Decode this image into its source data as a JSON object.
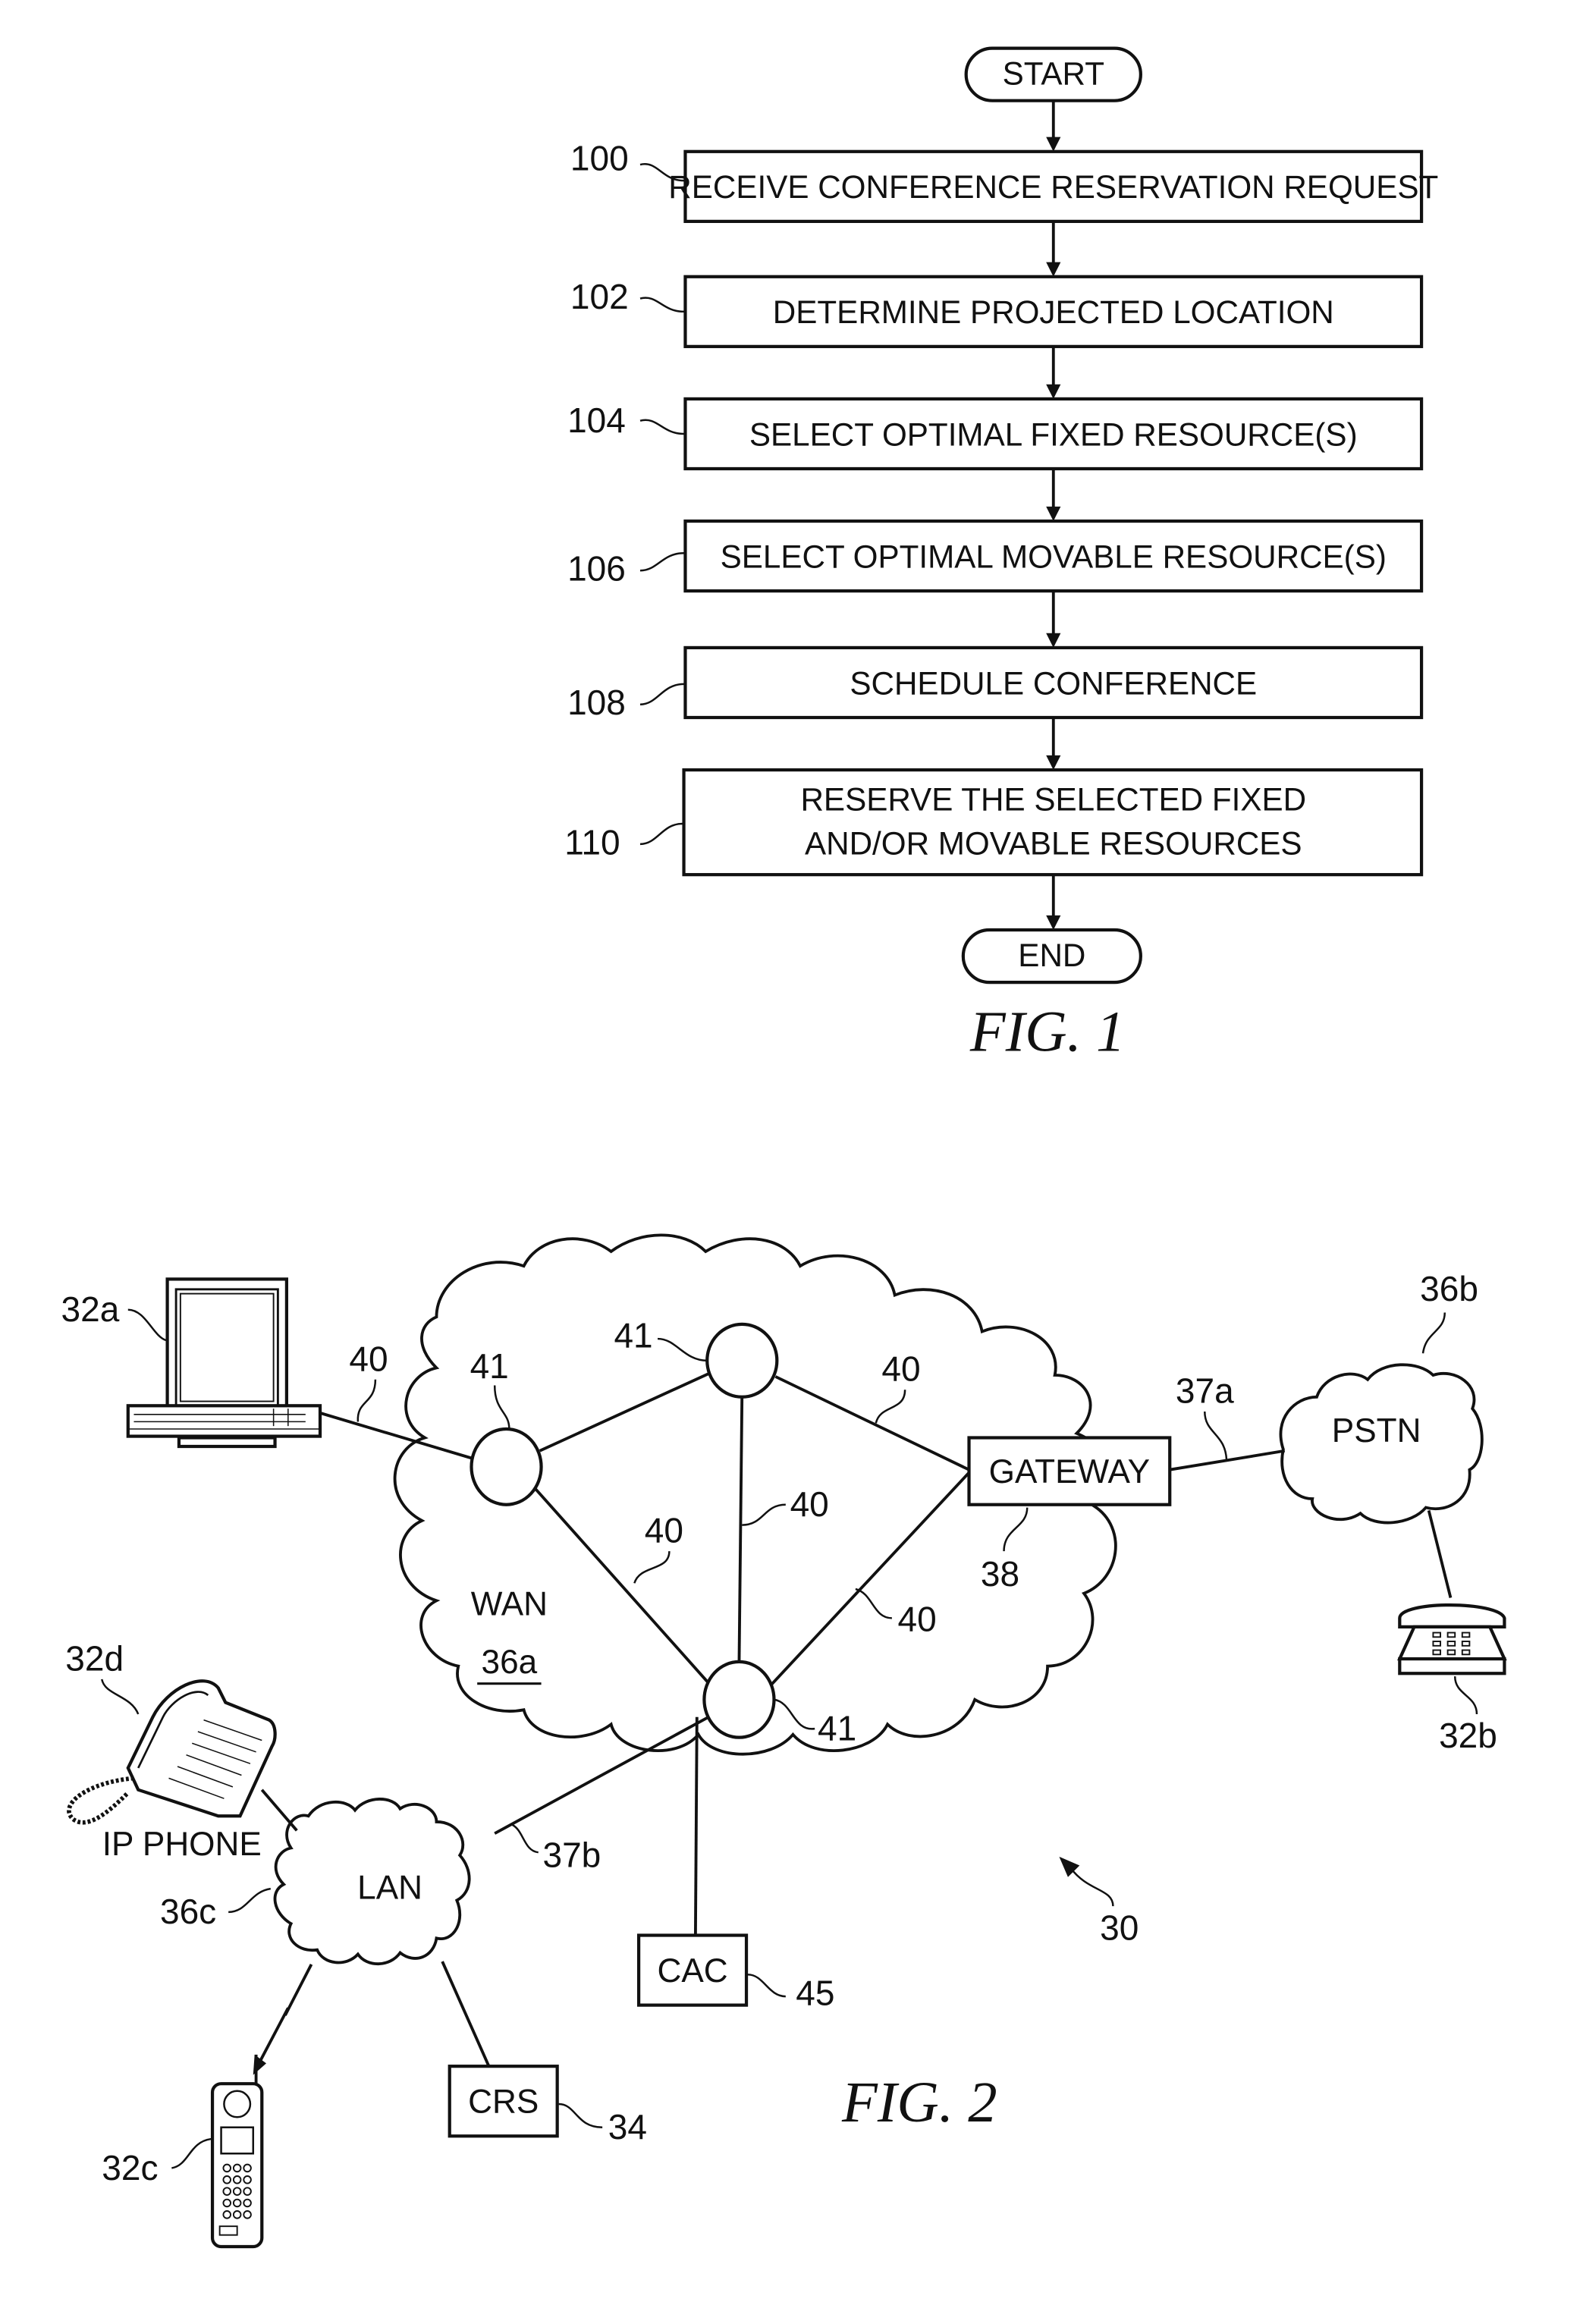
{
  "figure1": {
    "caption": "FIG. 1",
    "start_label": "START",
    "end_label": "END",
    "steps": [
      {
        "ref": "100",
        "lines": [
          "RECEIVE CONFERENCE RESERVATION REQUEST"
        ]
      },
      {
        "ref": "102",
        "lines": [
          "DETERMINE PROJECTED LOCATION"
        ]
      },
      {
        "ref": "104",
        "lines": [
          "SELECT OPTIMAL FIXED RESOURCE(S)"
        ]
      },
      {
        "ref": "106",
        "lines": [
          "SELECT OPTIMAL MOVABLE RESOURCE(S)"
        ]
      },
      {
        "ref": "108",
        "lines": [
          "SCHEDULE CONFERENCE"
        ]
      },
      {
        "ref": "110",
        "lines": [
          "RESERVE THE SELECTED FIXED",
          "AND/OR MOVABLE RESOURCES"
        ]
      }
    ]
  },
  "figure2": {
    "caption": "FIG. 2",
    "system_ref": "30",
    "wan": {
      "label": "WAN",
      "ref": "36a"
    },
    "pstn": {
      "label": "PSTN",
      "ref": "36b"
    },
    "lan": {
      "label": "LAN",
      "ref": "36c"
    },
    "gateway": {
      "label": "GATEWAY",
      "ref": "38"
    },
    "cac": {
      "label": "CAC",
      "ref": "45"
    },
    "crs": {
      "label": "CRS",
      "ref": "34"
    },
    "computer": {
      "ref": "32a"
    },
    "phone": {
      "ref": "32b"
    },
    "cell_phone": {
      "ref": "32c"
    },
    "ip_phone": {
      "label": "IP PHONE",
      "ref": "32d"
    },
    "link_refs": {
      "gateway_pstn": "37a",
      "wan_lan": "37b",
      "link": "40"
    },
    "node_ref": "41"
  }
}
